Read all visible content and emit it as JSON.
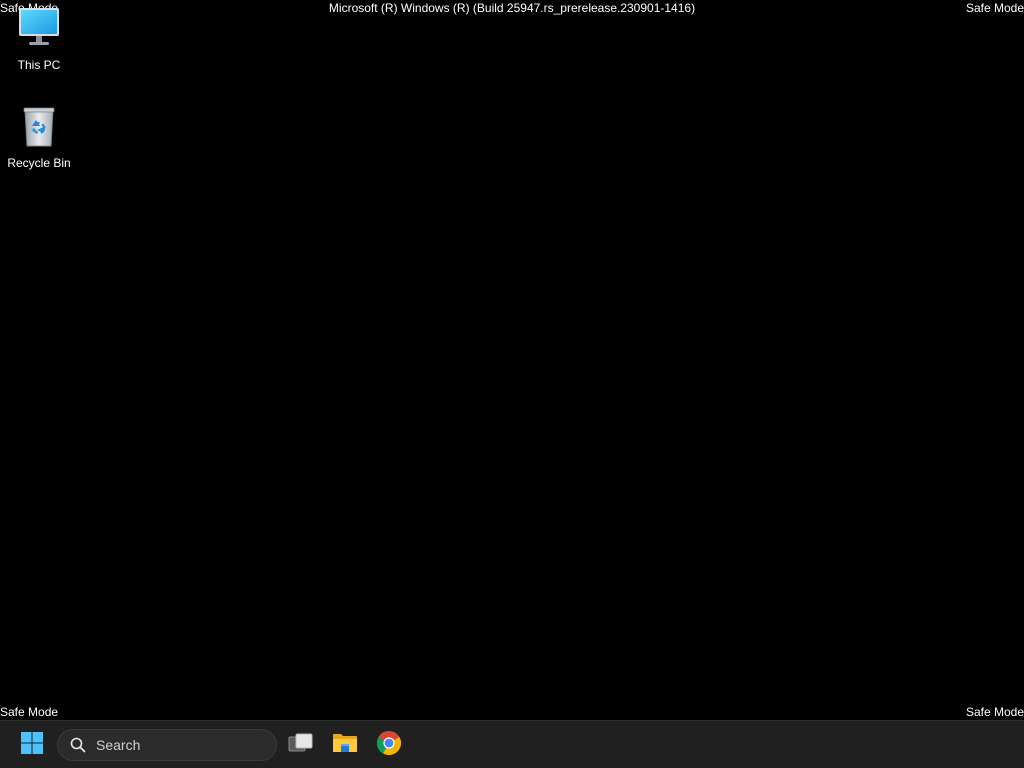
{
  "overlay": {
    "safe_mode_label": "Safe Mode",
    "build_title": "Microsoft (R) Windows (R) (Build 25947.rs_prerelease.230901-1416)"
  },
  "desktop": {
    "background_color": "#000000",
    "icons": [
      {
        "label": "This PC",
        "icon": "monitor-icon"
      },
      {
        "label": "Recycle Bin",
        "icon": "recycle-bin-icon"
      }
    ]
  },
  "taskbar": {
    "background_color": "#202020",
    "start_icon": "windows-logo-icon",
    "search": {
      "placeholder": "Search",
      "icon": "search-icon"
    },
    "pinned": [
      {
        "name": "Task View",
        "icon": "task-view-icon"
      },
      {
        "name": "File Explorer",
        "icon": "folder-icon"
      },
      {
        "name": "Google Chrome",
        "icon": "chrome-icon"
      }
    ]
  }
}
